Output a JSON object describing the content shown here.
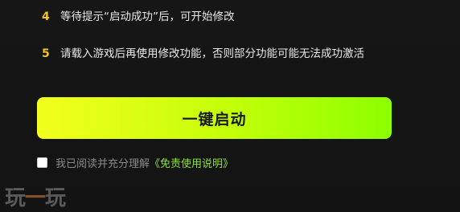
{
  "steps": [
    {
      "number": "4",
      "text": "等待提示“启动成功”后，可开始修改"
    },
    {
      "number": "5",
      "text": "请载入游戏后再使用修改功能，否则部分功能可能无法成功激活"
    }
  ],
  "launch_button": {
    "label": "一键启动"
  },
  "agreement": {
    "text": "我已阅读并充分理解",
    "link_text": "《免责使用说明》",
    "checked": false
  },
  "watermark": {
    "left": "玩",
    "mid": "一",
    "right": "玩"
  },
  "colors": {
    "step_number": "#f5c518",
    "button_gradient_start": "#f3ff1c",
    "button_gradient_end": "#8dff00",
    "link": "#8fe03a"
  }
}
